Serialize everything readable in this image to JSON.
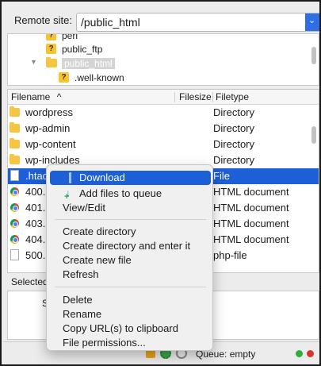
{
  "remote_site": {
    "label": "Remote site:",
    "value": "/public_html"
  },
  "tree": {
    "items": [
      {
        "label": "perl"
      },
      {
        "label": "public_ftp"
      },
      {
        "label": "public_html"
      },
      {
        "label": ".well-known"
      }
    ]
  },
  "list": {
    "headers": {
      "filename": "Filename",
      "filesize": "Filesize",
      "filetype": "Filetype"
    },
    "rows": [
      {
        "name": "wordpress",
        "type": "Directory"
      },
      {
        "name": "wp-admin",
        "type": "Directory"
      },
      {
        "name": "wp-content",
        "type": "Directory"
      },
      {
        "name": "wp-includes",
        "type": "Directory"
      },
      {
        "name": ".htac",
        "type": "File"
      },
      {
        "name": "400.",
        "type": "HTML document"
      },
      {
        "name": "401.",
        "type": "HTML document"
      },
      {
        "name": "403.",
        "type": "HTML document"
      },
      {
        "name": "404.",
        "type": "HTML document"
      },
      {
        "name": "500.",
        "type": "php-file"
      }
    ]
  },
  "status": {
    "selected": "Selected"
  },
  "queue_panel": {
    "col1": "S"
  },
  "bottom": {
    "queue": "Queue: empty"
  },
  "menu": {
    "group1": [
      "Download",
      "Add files to queue",
      "View/Edit"
    ],
    "group2": [
      "Create directory",
      "Create directory and enter it",
      "Create new file",
      "Refresh"
    ],
    "group3": [
      "Delete",
      "Rename",
      "Copy URL(s) to clipboard",
      "File permissions..."
    ]
  },
  "colors": {
    "selection": "#1c5fd6",
    "folder": "#f5c544",
    "accent": "#2f6fe4"
  }
}
